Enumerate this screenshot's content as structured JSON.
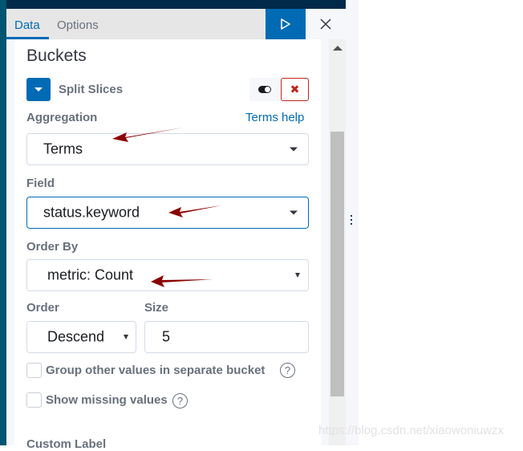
{
  "tabs": [
    {
      "label": "Data",
      "active": true
    },
    {
      "label": "Options",
      "active": false
    }
  ],
  "toolbar": {
    "run_icon": "play-icon",
    "close_icon": "close-icon"
  },
  "buckets": {
    "title": "Buckets",
    "agg_type_label": "Split Slices",
    "remove_icon": "✖",
    "aggregation": {
      "label": "Aggregation",
      "help_link": "Terms help",
      "value": "Terms"
    },
    "field": {
      "label": "Field",
      "value": "status.keyword"
    },
    "order_by": {
      "label": "Order By",
      "value": "metric: Count"
    },
    "order": {
      "label": "Order",
      "value": "Descend"
    },
    "size": {
      "label": "Size",
      "value": "5"
    },
    "group_other": {
      "label": "Group other values in separate bucket",
      "checked": false,
      "help": "?"
    },
    "show_missing": {
      "label": "Show missing values",
      "checked": false,
      "help": "?"
    },
    "custom_label": "Custom Label"
  },
  "colors": {
    "primary": "#006bb4",
    "danger": "#bd271e",
    "annotation_arrow": "#8b0000"
  },
  "watermark": "https://blog.csdn.net/xiaowoniuwzx"
}
